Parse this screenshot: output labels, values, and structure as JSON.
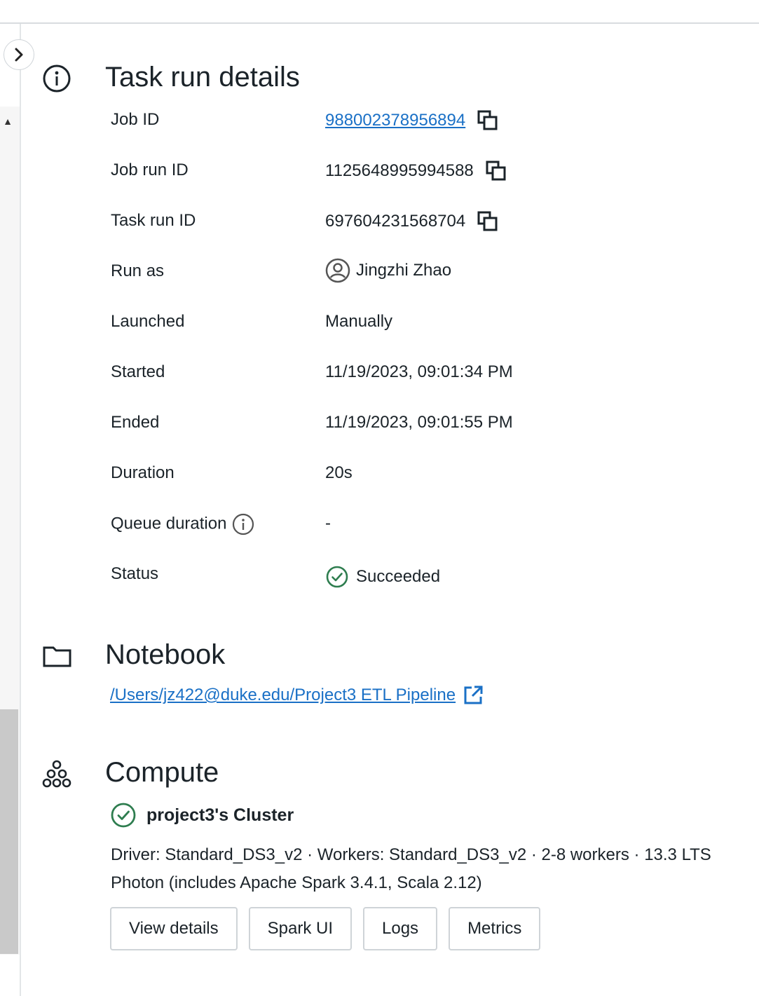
{
  "task_run": {
    "title": "Task run details",
    "rows": [
      {
        "label": "Job ID",
        "value": "988002378956894"
      },
      {
        "label": "Job run ID",
        "value": "1125648995994588"
      },
      {
        "label": "Task run ID",
        "value": "697604231568704"
      },
      {
        "label": "Run as",
        "value": "Jingzhi Zhao"
      },
      {
        "label": "Launched",
        "value": "Manually"
      },
      {
        "label": "Started",
        "value": "11/19/2023, 09:01:34 PM"
      },
      {
        "label": "Ended",
        "value": "11/19/2023, 09:01:55 PM"
      },
      {
        "label": "Duration",
        "value": "20s"
      },
      {
        "label": "Queue duration",
        "value": "-"
      },
      {
        "label": "Status",
        "value": "Succeeded"
      }
    ]
  },
  "notebook": {
    "title": "Notebook",
    "path": "/Users/jz422@duke.edu/Project3 ETL Pipeline"
  },
  "compute": {
    "title": "Compute",
    "cluster_name": "project3's Cluster",
    "description": "Driver: Standard_DS3_v2 · Workers: Standard_DS3_v2 · 2-8 workers · 13.3 LTS Photon (includes Apache Spark 3.4.1, Scala 2.12)",
    "buttons": [
      "View details",
      "Spark UI",
      "Logs",
      "Metrics"
    ]
  },
  "colors": {
    "link": "#1a70c6",
    "success": "#2e7d4f",
    "text": "#1b2329"
  },
  "icons": [
    "chevron-right-icon",
    "info-icon",
    "copy-icon",
    "user-circle-icon",
    "check-circle-icon",
    "folder-icon",
    "external-link-icon",
    "cluster-icon"
  ]
}
